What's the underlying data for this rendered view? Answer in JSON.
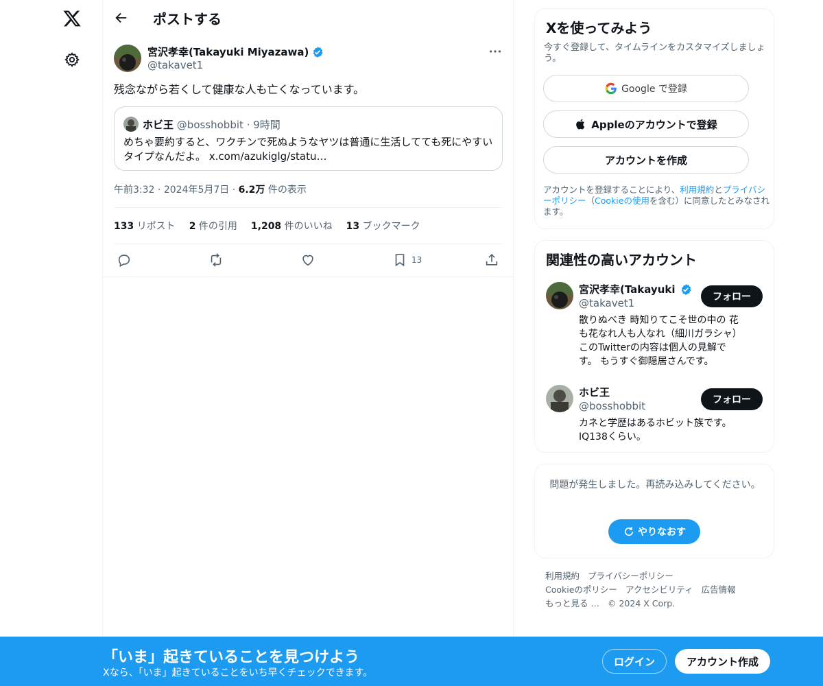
{
  "nav": {
    "logo_icon": "x-logo-icon",
    "settings_icon": "gear-icon"
  },
  "header": {
    "title": "ポストする",
    "back_icon": "arrow-left-icon"
  },
  "post": {
    "author_name": "宮沢孝幸(Takayuki Miyazawa)",
    "verified": true,
    "handle": "@takavet1",
    "text": "残念ながら若くして健康な人も亡くなっています。",
    "quote": {
      "author_name": "ホビ王",
      "handle": "@bosshobbit",
      "separator": "·",
      "time": "9時間",
      "text": "めちゃ要約すると、ワクチンで死ぬようなヤツは普通に生活してても死にやすいタイプなんだよ。 x.com/azukiglg/statu…"
    },
    "time": "午前3:32",
    "date": "2024年5月7日",
    "views": "6.2万",
    "views_label": "件の表示",
    "stats": {
      "reposts": "133",
      "reposts_label": "リポスト",
      "quotes": "2",
      "quotes_label": "件の引用",
      "likes": "1,208",
      "likes_label": "件のいいね",
      "bookmarks": "13",
      "bookmarks_label": "ブックマーク"
    },
    "actions": {
      "bookmark_count": "13"
    }
  },
  "signup": {
    "title": "Xを使ってみよう",
    "subtitle": "今すぐ登録して、タイムラインをカスタマイズしましょう。",
    "google_label": "Google で登録",
    "apple_label": "Appleのアカウントで登録",
    "create_label": "アカウントを作成",
    "terms": {
      "prefix": "アカウントを登録することにより、",
      "tos": "利用規約",
      "and": "と",
      "privacy": "プライバシーポリシー",
      "paren_open": "（",
      "cookie": "Cookieの使用",
      "suffix": "を含む）に同意したとみなされます。"
    }
  },
  "related": {
    "title": "関連性の高いアカウント",
    "accounts": [
      {
        "name": "宮沢孝幸(Takayuki Miyazawa)",
        "verified": true,
        "handle": "@takavet1",
        "bio": "散りぬべき 時知りてこそ世の中の 花も花なれ人も人なれ（細川ガラシャ） このTwitterの内容は個人の見解です。 もうすぐ御隠居さんです。",
        "follow_label": "フォロー"
      },
      {
        "name": "ホビ王",
        "verified": false,
        "handle": "@bosshobbit",
        "bio": "カネと学歴はあるホビット族です。IQ138くらい。",
        "follow_label": "フォロー"
      }
    ]
  },
  "error": {
    "message": "問題が発生しました。再読み込みしてください。",
    "retry_label": "やりなおす"
  },
  "footer": {
    "links_row1": [
      "利用規約",
      "プライバシーポリシー"
    ],
    "links_row2": [
      "Cookieのポリシー",
      "アクセシビリティ",
      "広告情報"
    ],
    "more": "もっと見る …",
    "copyright": "© 2024 X Corp."
  },
  "banner": {
    "title": "「いま」起きていることを見つけよう",
    "subtitle": "Xなら、「いま」起きていることをいち早くチェックできます。",
    "login_label": "ログイン",
    "create_label": "アカウント作成"
  },
  "colors": {
    "accent": "#1d9bf0",
    "text": "#0f1419",
    "muted": "#536471",
    "border": "#eff3f4"
  }
}
